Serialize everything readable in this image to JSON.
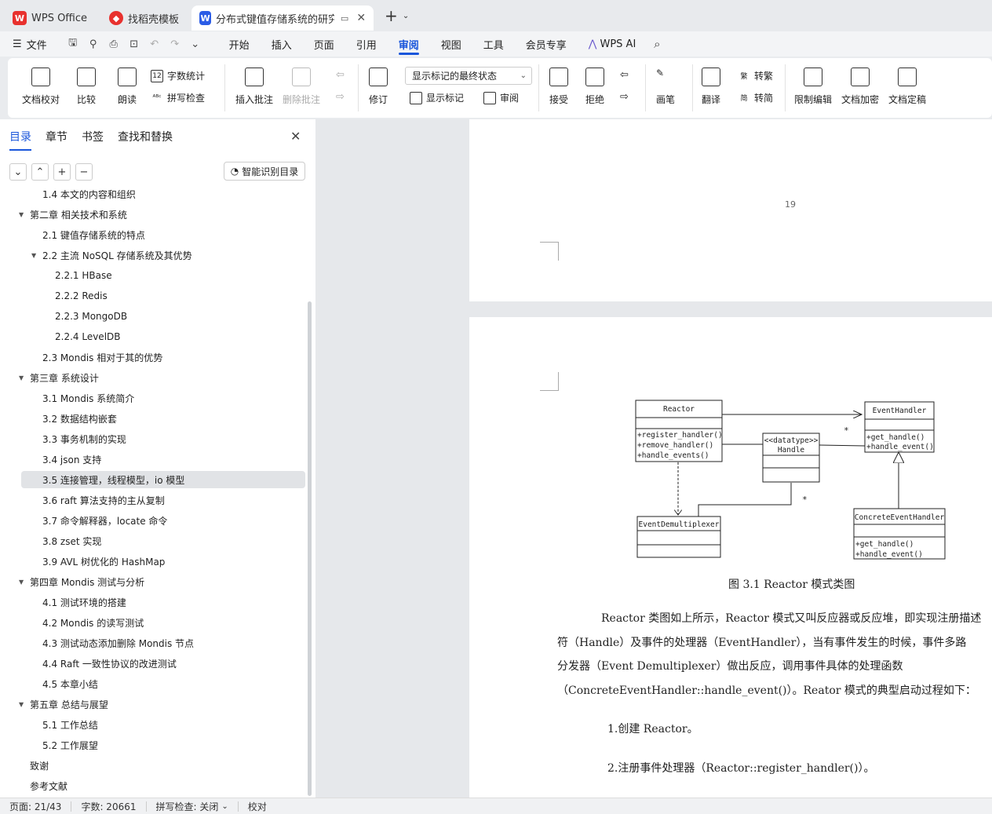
{
  "tabs": [
    {
      "label": "WPS Office",
      "icon": "wps-logo-icon",
      "color": "#e8312e"
    },
    {
      "label": "找稻壳模板",
      "icon": "docer-icon",
      "color": "#e8312e"
    },
    {
      "label": "分布式键值存储系统的研究和实",
      "icon": "wps-writer-icon",
      "color": "#2b5ce6"
    }
  ],
  "menu": {
    "file": "文件",
    "items": [
      "开始",
      "插入",
      "页面",
      "引用",
      "审阅",
      "视图",
      "工具",
      "会员专享"
    ],
    "active": "审阅",
    "wps_ai": "WPS AI"
  },
  "ribbon": {
    "doc_proof": "文档校对",
    "compare": "比较",
    "read_aloud": "朗读",
    "word_count": "字数统计",
    "spell_check": "拼写检查",
    "insert_comment": "插入批注",
    "delete_comment": "删除批注",
    "track_changes": "修订",
    "markup_state": "显示标记的最终状态",
    "show_markup": "显示标记",
    "review": "审阅",
    "accept": "接受",
    "reject": "拒绝",
    "pen": "画笔",
    "translate": "翻译",
    "trad": "转繁",
    "simp": "转简",
    "restrict_edit": "限制编辑",
    "encrypt": "文档加密",
    "finalize": "文档定稿"
  },
  "nav": {
    "tabs": [
      "目录",
      "章节",
      "书签",
      "查找和替换"
    ],
    "smart_toc": "智能识别目录",
    "toc": [
      {
        "text": "1.4  本文的内容和组织",
        "level": 2
      },
      {
        "text": "第二章  相关技术和系统",
        "level": 1,
        "expanded": true
      },
      {
        "text": "2.1  键值存储系统的特点",
        "level": 2
      },
      {
        "text": "2.2  主流 NoSQL 存储系统及其优势",
        "level": 2,
        "expanded": true
      },
      {
        "text": "2.2.1 HBase",
        "level": 3
      },
      {
        "text": "2.2.2 Redis",
        "level": 3
      },
      {
        "text": "2.2.3 MongoDB",
        "level": 3
      },
      {
        "text": "2.2.4 LevelDB",
        "level": 3
      },
      {
        "text": "2.3 Mondis 相对于其的优势",
        "level": 2
      },
      {
        "text": "第三章  系统设计",
        "level": 1,
        "expanded": true
      },
      {
        "text": "3.1 Mondis 系统简介",
        "level": 2
      },
      {
        "text": "3.2  数据结构嵌套",
        "level": 2
      },
      {
        "text": "3.3  事务机制的实现",
        "level": 2
      },
      {
        "text": "3.4 json 支持",
        "level": 2
      },
      {
        "text": "3.5  连接管理，线程模型，io 模型",
        "level": 2,
        "selected": true
      },
      {
        "text": "3.6 raft 算法支持的主从复制",
        "level": 2
      },
      {
        "text": "3.7  命令解释器，locate 命令",
        "level": 2
      },
      {
        "text": "3.8 zset 实现",
        "level": 2
      },
      {
        "text": "3.9 AVL 树优化的 HashMap",
        "level": 2
      },
      {
        "text": "第四章  Mondis 测试与分析",
        "level": 1,
        "expanded": true
      },
      {
        "text": "4.1  测试环境的搭建",
        "level": 2
      },
      {
        "text": "4.2 Mondis 的读写测试",
        "level": 2
      },
      {
        "text": "4.3  测试动态添加删除 Mondis 节点",
        "level": 2
      },
      {
        "text": "4.4 Raft 一致性协议的改进测试",
        "level": 2
      },
      {
        "text": "4.5  本章小结",
        "level": 2
      },
      {
        "text": "第五章  总结与展望",
        "level": 1,
        "expanded": true
      },
      {
        "text": "5.1  工作总结",
        "level": 2
      },
      {
        "text": "5.2  工作展望",
        "level": 2
      },
      {
        "text": "致谢",
        "level": 1
      },
      {
        "text": "参考文献",
        "level": 1
      }
    ]
  },
  "doc": {
    "page_number": "19",
    "uml": {
      "reactor": {
        "name": "Reactor",
        "methods": [
          "+register_handler()",
          "+remove_handler()",
          "+handle_events()"
        ]
      },
      "event_handler": {
        "name": "EventHandler",
        "methods": [
          "+get_handle()",
          "+handle_event()"
        ]
      },
      "handle": {
        "stereotype": "<<datatype>>",
        "name": "Handle"
      },
      "demux": {
        "name": "EventDemultiplexer"
      },
      "concrete": {
        "name": "ConcreteEventHandler",
        "methods": [
          "+get_handle()",
          "+handle_event()"
        ]
      },
      "mult1": "*",
      "mult2": "*"
    },
    "caption": "图  3.1 Reactor 模式类图",
    "paragraphs": [
      "Reactor 类图如上所示，Reactor 模式又叫反应器或反应堆，即实现注册描述",
      "符（Handle）及事件的处理器（EventHandler），当有事件发生的时候，事件多路",
      "分发器（Event Demultiplexer）做出反应，调用事件具体的处理函数",
      "（ConcreteEventHandler::handle_event()）。Reator 模式的典型启动过程如下："
    ],
    "steps": [
      "1.创建 Reactor。",
      "2.注册事件处理器（Reactor::register_handler()）。"
    ]
  },
  "status": {
    "page": "页面: 21/43",
    "words": "字数: 20661",
    "spell": "拼写检查: 关闭",
    "proof": "校对"
  },
  "colors": {
    "accent": "#1a56db",
    "wps_red": "#e8312e",
    "writer_blue": "#2b5ce6"
  }
}
